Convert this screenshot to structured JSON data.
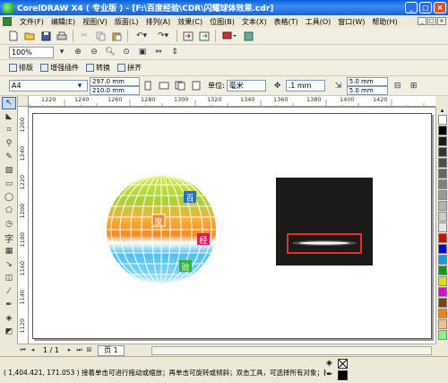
{
  "window": {
    "title": "CorelDRAW X4 ( 专业版 ) - [F:\\百度经验\\CDR\\闪耀球体效果.cdr]",
    "controls": {
      "minimize": "_",
      "maximize": "□",
      "close": "×"
    }
  },
  "menu": {
    "items": [
      "文件(F)",
      "编辑(E)",
      "视图(V)",
      "版面(L)",
      "排列(A)",
      "效果(C)",
      "位图(B)",
      "文本(X)",
      "表格(T)",
      "工具(O)",
      "窗口(W)",
      "帮助(H)"
    ]
  },
  "standard_toolbar": {
    "icons": [
      "new-icon",
      "open-icon",
      "save-icon",
      "print-icon",
      "cut-icon",
      "copy-icon",
      "paste-icon",
      "undo-icon",
      "redo-icon",
      "import-icon",
      "export-icon",
      "application-launcher-icon"
    ]
  },
  "zoom_toolbar": {
    "zoom_level": "100%"
  },
  "plugin_toolbar": {
    "buttons": [
      "排版",
      "增强插件",
      "转换",
      "拼齐"
    ]
  },
  "property_bar": {
    "paper_size": "A4",
    "width": "297.0 mm",
    "height": "210.0 mm",
    "units_label": "单位:",
    "units_value": "毫米",
    "nudge_value": ".1 mm",
    "duplicate_x": "5.0 mm",
    "duplicate_y": "5.0 mm"
  },
  "ruler": {
    "h_labels": [
      "1220",
      "1240",
      "1260",
      "1280",
      "1300",
      "1320",
      "1340",
      "1360",
      "1380",
      "1400",
      "1420"
    ],
    "v_labels": [
      "1260",
      "1240",
      "1220",
      "1200",
      "1180",
      "1160",
      "1140",
      "1120"
    ]
  },
  "canvas": {
    "sphere_labels": [
      {
        "text": "百",
        "color": "#1e6fd9"
      },
      {
        "text": "度",
        "color": "#f08a24"
      },
      {
        "text": "经",
        "color": "#e8175d"
      },
      {
        "text": "验",
        "color": "#2fb82f"
      }
    ],
    "preview": {
      "background": "#1c1a18",
      "highlight_box_color": "#e0312b"
    }
  },
  "page_nav": {
    "page_counter": "1 / 1",
    "page_tab": "页 1"
  },
  "status": {
    "coordinates": "( 1,404.421, 171.053 )",
    "hint": "接着单击可进行拖动或缩放；再单击可旋转或倾斜；双击工具，可选择所有对象；按住 Shi..."
  },
  "palette": {
    "colors": [
      "#ffffff",
      "#000000",
      "#1a1a1a",
      "#333333",
      "#4d4d4d",
      "#666666",
      "#808080",
      "#999999",
      "#b3b3b3",
      "#cccccc",
      "#e6e6e6",
      "#e00000",
      "#0000e0",
      "#00a0e0",
      "#00a000",
      "#e0e000",
      "#e000e0",
      "#804000",
      "#ff8000",
      "#ffc080",
      "#80ff80"
    ]
  }
}
